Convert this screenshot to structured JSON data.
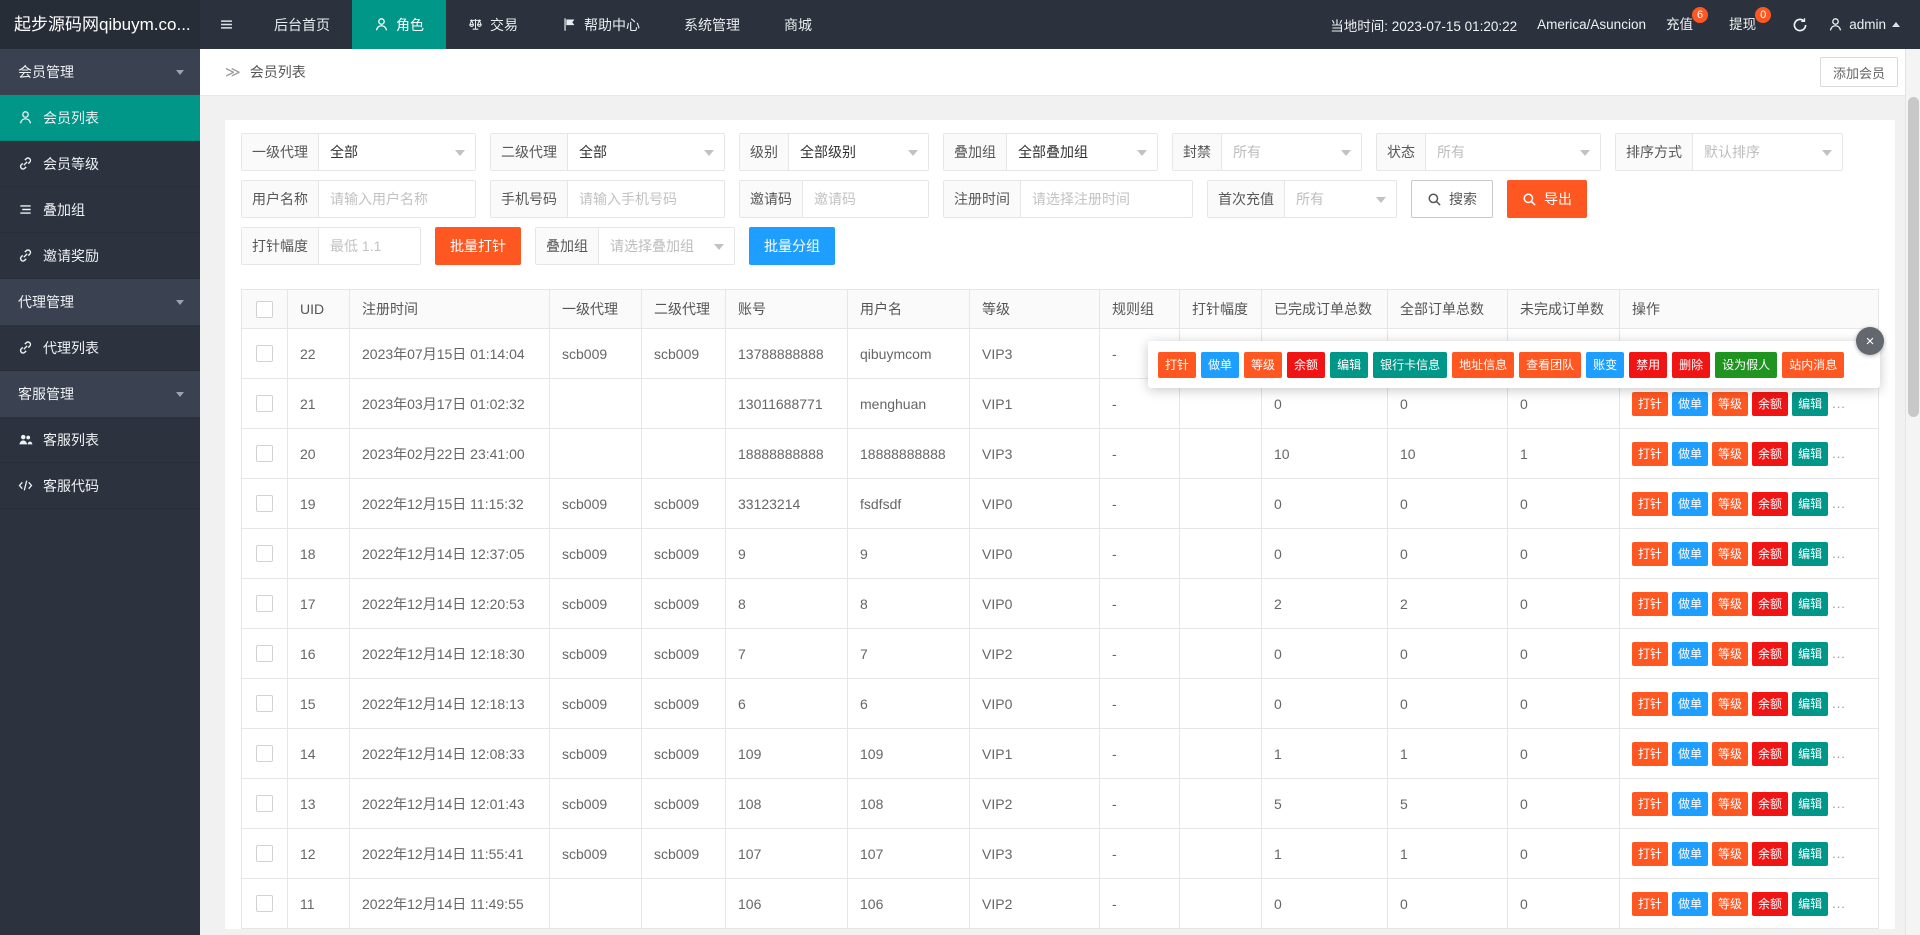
{
  "colors": {
    "teal": "#009688",
    "orange": "#ff5722",
    "blue": "#1e9fff",
    "red": "#f01414",
    "green": "#209420",
    "topbar_bg": "#2c323d",
    "sidebar_bg": "#2d333e"
  },
  "topbar": {
    "logo": "起步源码网qibuym.co...",
    "menu": [
      {
        "name": "home",
        "label": "后台首页",
        "icon": null,
        "active": false
      },
      {
        "name": "role",
        "label": "角色",
        "icon": "person",
        "active": true
      },
      {
        "name": "trade",
        "label": "交易",
        "icon": "scales",
        "active": false
      },
      {
        "name": "help-center",
        "label": "帮助中心",
        "icon": "flag",
        "active": false
      },
      {
        "name": "system",
        "label": "系统管理",
        "icon": null,
        "active": false
      },
      {
        "name": "mall",
        "label": "商城",
        "icon": null,
        "active": false
      }
    ],
    "local_time_label": "当地时间: 2023-07-15 01:20:22",
    "timezone": "America/Asuncion",
    "recharge": {
      "label": "充值",
      "badge": "6"
    },
    "withdraw": {
      "label": "提现",
      "badge": "0"
    },
    "username": "admin"
  },
  "sidebar": {
    "groups": [
      {
        "name": "member-management",
        "label": "会员管理",
        "items": [
          {
            "name": "member-list",
            "label": "会员列表",
            "icon": "person",
            "active": true
          },
          {
            "name": "member-level",
            "label": "会员等级",
            "icon": "link",
            "active": false
          },
          {
            "name": "stack-group",
            "label": "叠加组",
            "icon": "list",
            "active": false
          },
          {
            "name": "invite-reward",
            "label": "邀请奖励",
            "icon": "link",
            "active": false
          }
        ]
      },
      {
        "name": "agent-management",
        "label": "代理管理",
        "items": [
          {
            "name": "agent-list",
            "label": "代理列表",
            "icon": "link",
            "active": false
          }
        ]
      },
      {
        "name": "service-management",
        "label": "客服管理",
        "items": [
          {
            "name": "service-list",
            "label": "客服列表",
            "icon": "people",
            "active": false
          },
          {
            "name": "service-code",
            "label": "客服代码",
            "icon": "code",
            "active": false
          }
        ]
      }
    ]
  },
  "breadcrumb": {
    "arrow": "≫",
    "title": "会员列表",
    "add_button": "添加会员"
  },
  "filters": {
    "row1": [
      {
        "name": "agent1-filter",
        "label": "一级代理",
        "value": "全部",
        "muted": false
      },
      {
        "name": "agent2-filter",
        "label": "二级代理",
        "value": "全部",
        "muted": false
      },
      {
        "name": "level-filter",
        "label": "级别",
        "value": "全部级别",
        "muted": false
      },
      {
        "name": "stack-group-filter",
        "label": "叠加组",
        "value": "全部叠加组",
        "muted": false
      },
      {
        "name": "ban-filter",
        "label": "封禁",
        "value": "所有",
        "muted": true
      },
      {
        "name": "status-filter",
        "label": "状态",
        "value": "所有",
        "muted": true
      },
      {
        "name": "sort-filter",
        "label": "排序方式",
        "value": "默认排序",
        "muted": true
      }
    ],
    "row2_inputs": [
      {
        "name": "username-input",
        "label": "用户名称",
        "placeholder": "请输入用户名称"
      },
      {
        "name": "phone-input",
        "label": "手机号码",
        "placeholder": "请输入手机号码"
      },
      {
        "name": "invite-code-input",
        "label": "邀请码",
        "placeholder": "邀请码"
      },
      {
        "name": "reg-time-input",
        "label": "注册时间",
        "placeholder": "请选择注册时间"
      }
    ],
    "first_recharge_filter": {
      "name": "first-recharge-filter",
      "label": "首次充值",
      "value": "所有",
      "muted": true
    },
    "search_button": "搜索",
    "export_button": "导出",
    "row3": {
      "inject_label": "打针幅度",
      "inject_placeholder": "最低 1.1",
      "batch_inject_button": "批量打针",
      "group_label": "叠加组",
      "group_value": "请选择叠加组",
      "batch_group_button": "批量分组"
    }
  },
  "table": {
    "headers": [
      "UID",
      "注册时间",
      "一级代理",
      "二级代理",
      "账号",
      "用户名",
      "等级",
      "规则组",
      "打针幅度",
      "已完成订单总数",
      "全部订单总数",
      "未完成订单数",
      "操作"
    ],
    "row_actions": [
      {
        "name": "inject",
        "label": "打针",
        "color": "orange"
      },
      {
        "name": "make-order",
        "label": "做单",
        "color": "blue"
      },
      {
        "name": "level",
        "label": "等级",
        "color": "orange"
      },
      {
        "name": "balance",
        "label": "余额",
        "color": "red"
      },
      {
        "name": "edit",
        "label": "编辑",
        "color": "teal"
      }
    ],
    "more_label": "...",
    "rows": [
      {
        "uid": "22",
        "reg_time": "2023年07月15日 01:14:04",
        "agent1": "scb009",
        "agent2": "scb009",
        "account": "13788888888",
        "username": "qibuymcom",
        "level": "VIP3",
        "rule_group": "-",
        "inject_range": "",
        "done_orders": "",
        "all_orders": "",
        "undone_orders": "",
        "actions_covered": true
      },
      {
        "uid": "21",
        "reg_time": "2023年03月17日 01:02:32",
        "agent1": "",
        "agent2": "",
        "account": "13011688771",
        "username": "menghuan",
        "level": "VIP1",
        "rule_group": "-",
        "inject_range": "",
        "done_orders": "0",
        "all_orders": "0",
        "undone_orders": "0",
        "actions_covered": false
      },
      {
        "uid": "20",
        "reg_time": "2023年02月22日 23:41:00",
        "agent1": "",
        "agent2": "",
        "account": "18888888888",
        "username": "18888888888",
        "level": "VIP3",
        "rule_group": "-",
        "inject_range": "",
        "done_orders": "10",
        "all_orders": "10",
        "undone_orders": "1",
        "actions_covered": false
      },
      {
        "uid": "19",
        "reg_time": "2022年12月15日 11:15:32",
        "agent1": "scb009",
        "agent2": "scb009",
        "account": "33123214",
        "username": "fsdfsdf",
        "level": "VIP0",
        "rule_group": "-",
        "inject_range": "",
        "done_orders": "0",
        "all_orders": "0",
        "undone_orders": "0",
        "actions_covered": false
      },
      {
        "uid": "18",
        "reg_time": "2022年12月14日 12:37:05",
        "agent1": "scb009",
        "agent2": "scb009",
        "account": "9",
        "username": "9",
        "level": "VIP0",
        "rule_group": "-",
        "inject_range": "",
        "done_orders": "0",
        "all_orders": "0",
        "undone_orders": "0",
        "actions_covered": false
      },
      {
        "uid": "17",
        "reg_time": "2022年12月14日 12:20:53",
        "agent1": "scb009",
        "agent2": "scb009",
        "account": "8",
        "username": "8",
        "level": "VIP0",
        "rule_group": "-",
        "inject_range": "",
        "done_orders": "2",
        "all_orders": "2",
        "undone_orders": "0",
        "actions_covered": false
      },
      {
        "uid": "16",
        "reg_time": "2022年12月14日 12:18:30",
        "agent1": "scb009",
        "agent2": "scb009",
        "account": "7",
        "username": "7",
        "level": "VIP2",
        "rule_group": "-",
        "inject_range": "",
        "done_orders": "0",
        "all_orders": "0",
        "undone_orders": "0",
        "actions_covered": false
      },
      {
        "uid": "15",
        "reg_time": "2022年12月14日 12:18:13",
        "agent1": "scb009",
        "agent2": "scb009",
        "account": "6",
        "username": "6",
        "level": "VIP0",
        "rule_group": "-",
        "inject_range": "",
        "done_orders": "0",
        "all_orders": "0",
        "undone_orders": "0",
        "actions_covered": false
      },
      {
        "uid": "14",
        "reg_time": "2022年12月14日 12:08:33",
        "agent1": "scb009",
        "agent2": "scb009",
        "account": "109",
        "username": "109",
        "level": "VIP1",
        "rule_group": "-",
        "inject_range": "",
        "done_orders": "1",
        "all_orders": "1",
        "undone_orders": "0",
        "actions_covered": false
      },
      {
        "uid": "13",
        "reg_time": "2022年12月14日 12:01:43",
        "agent1": "scb009",
        "agent2": "scb009",
        "account": "108",
        "username": "108",
        "level": "VIP2",
        "rule_group": "-",
        "inject_range": "",
        "done_orders": "5",
        "all_orders": "5",
        "undone_orders": "0",
        "actions_covered": false
      },
      {
        "uid": "12",
        "reg_time": "2022年12月14日 11:55:41",
        "agent1": "scb009",
        "agent2": "scb009",
        "account": "107",
        "username": "107",
        "level": "VIP3",
        "rule_group": "-",
        "inject_range": "",
        "done_orders": "1",
        "all_orders": "1",
        "undone_orders": "0",
        "actions_covered": false
      },
      {
        "uid": "11",
        "reg_time": "2022年12月14日 11:49:55",
        "agent1": "",
        "agent2": "",
        "account": "106",
        "username": "106",
        "level": "VIP2",
        "rule_group": "-",
        "inject_range": "",
        "done_orders": "0",
        "all_orders": "0",
        "undone_orders": "0",
        "actions_covered": false
      }
    ]
  },
  "popup": {
    "close_icon": "×",
    "buttons": [
      {
        "name": "inject",
        "label": "打针",
        "color": "orange"
      },
      {
        "name": "make-order",
        "label": "做单",
        "color": "blue"
      },
      {
        "name": "level",
        "label": "等级",
        "color": "orange"
      },
      {
        "name": "balance",
        "label": "余额",
        "color": "red"
      },
      {
        "name": "edit",
        "label": "编辑",
        "color": "teal"
      },
      {
        "name": "bank-info",
        "label": "银行卡信息",
        "color": "teal"
      },
      {
        "name": "address-info",
        "label": "地址信息",
        "color": "orange"
      },
      {
        "name": "view-team",
        "label": "查看团队",
        "color": "orange"
      },
      {
        "name": "account-change",
        "label": "账变",
        "color": "blue"
      },
      {
        "name": "disable",
        "label": "禁用",
        "color": "red"
      },
      {
        "name": "delete",
        "label": "删除",
        "color": "red"
      },
      {
        "name": "set-dummy",
        "label": "设为假人",
        "color": "green"
      },
      {
        "name": "site-message",
        "label": "站内消息",
        "color": "orange"
      }
    ]
  }
}
